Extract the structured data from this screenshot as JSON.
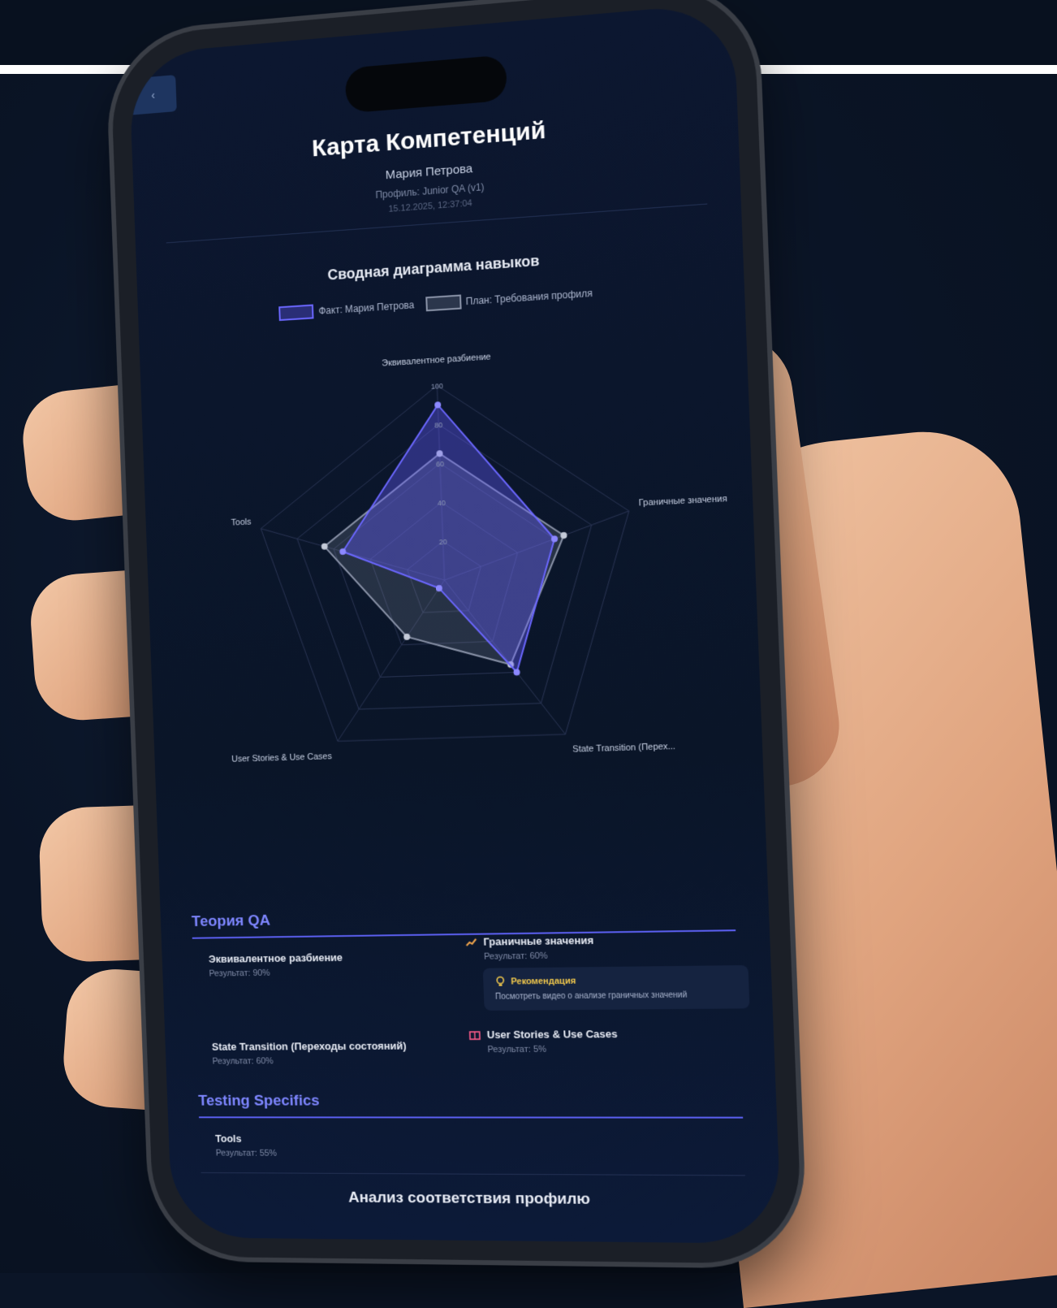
{
  "header": {
    "title": "Карта Компетенций",
    "user_name": "Мария Петрова",
    "profile": "Профиль: Junior QA (v1)",
    "datetime": "15.12.2025, 12:37:04"
  },
  "chart_section": {
    "title": "Сводная диаграмма навыков",
    "legend": [
      {
        "label": "Факт: Мария Петрова",
        "color": "#6b67ff"
      },
      {
        "label": "План: Требования профиля",
        "color": "#8a93a8"
      }
    ]
  },
  "chart_data": {
    "type": "radar",
    "axes": [
      "Эквивалентное разбиение",
      "Граничные значения",
      "State Transition (Переходы состояний)",
      "User Stories & Use Cases",
      "Tools"
    ],
    "axis_display": [
      "Эквивалентное разбиение",
      "Граничные значения",
      "State Transition (Перех...",
      "User Stories & Use Cases",
      "Tools"
    ],
    "ticks": [
      20,
      40,
      60,
      80,
      100
    ],
    "range": [
      0,
      100
    ],
    "series": [
      {
        "name": "Факт: Мария Петрова",
        "values": [
          90,
          60,
          60,
          5,
          55
        ],
        "color": "#6b67ff"
      },
      {
        "name": "План: Требования профиля",
        "values": [
          65,
          65,
          55,
          35,
          65
        ],
        "color": "#8a93a8"
      }
    ]
  },
  "categories": [
    {
      "title": "Теория QA",
      "skills": [
        {
          "name": "Эквивалентное разбиение",
          "result": "Результат: 90%"
        },
        {
          "name": "Граничные значения",
          "result": "Результат: 60%"
        },
        {
          "name": "State Transition (Переходы состояний)",
          "result": "Результат: 60%"
        },
        {
          "name": "User Stories & Use Cases",
          "result": "Результат: 5%"
        }
      ],
      "recommendation": {
        "title": "Рекомендация",
        "text": "Посмотреть видео о анализе граничных значений"
      }
    },
    {
      "title": "Testing Specifics",
      "skills": [
        {
          "name": "Tools",
          "result": "Результат: 55%"
        }
      ]
    }
  ],
  "bottom_section": {
    "title": "Анализ соответствия профилю"
  },
  "back_label": "‹",
  "colors": {
    "accent": "#6b67ff",
    "background": "#0b1527",
    "recommendation": "#f2c94c"
  }
}
